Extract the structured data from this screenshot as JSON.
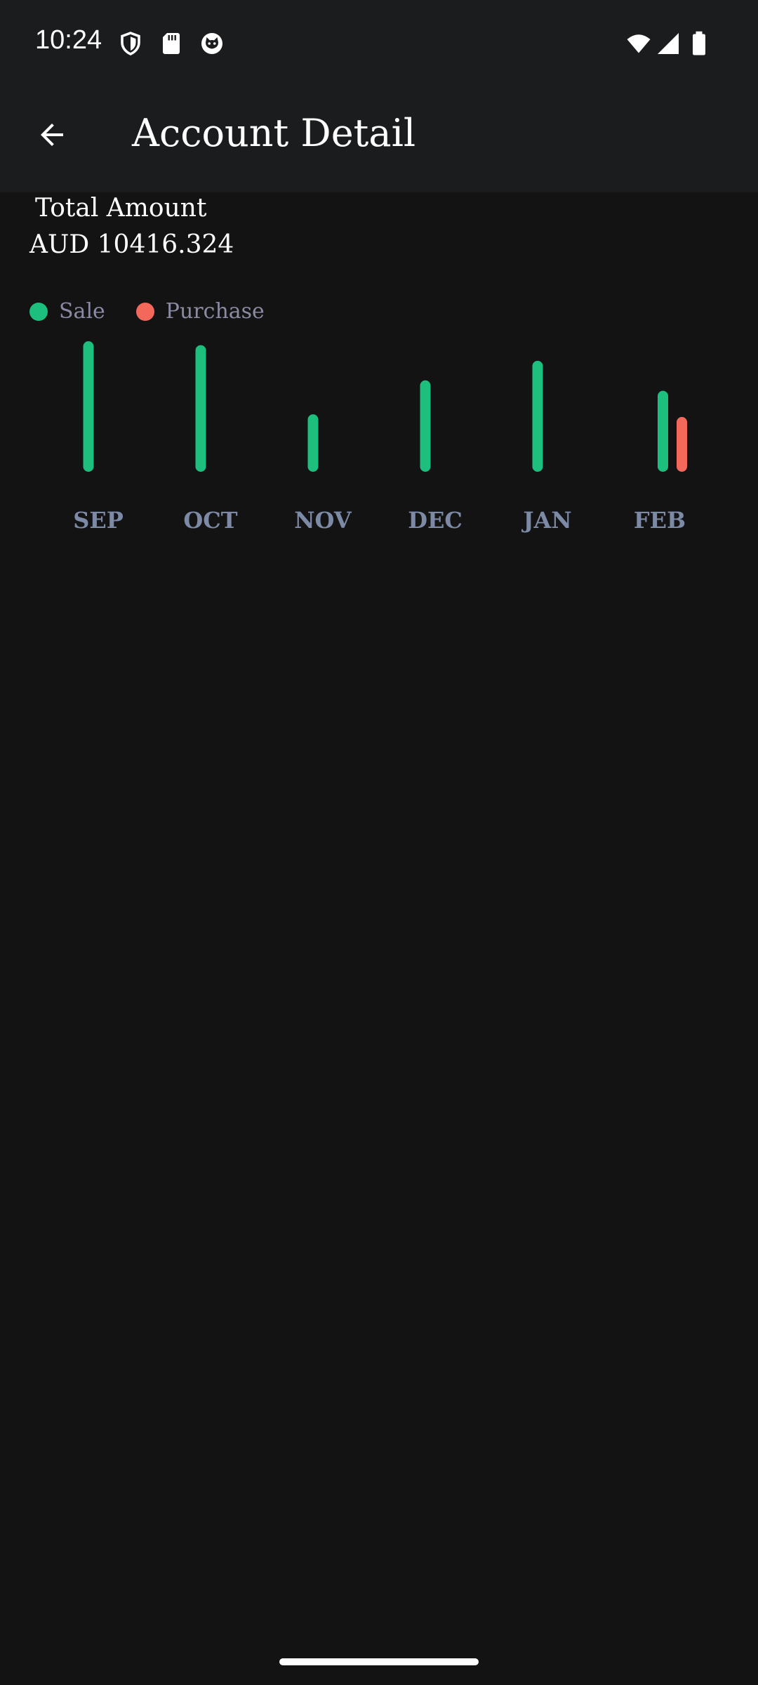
{
  "status_bar": {
    "time": "10:24",
    "left_icons": [
      "shield-icon",
      "sd-card-icon",
      "cat-face-icon"
    ],
    "right_icons": [
      "wifi-icon",
      "signal-icon",
      "battery-icon"
    ]
  },
  "app_bar": {
    "back_icon": "arrow-back-icon",
    "title": "Account Detail"
  },
  "summary": {
    "label": "Total Amount",
    "value": "AUD 10416.324"
  },
  "legend": [
    {
      "label": "Sale",
      "color": "#1cbf7e"
    },
    {
      "label": "Purchase",
      "color": "#f2685a"
    }
  ],
  "chart_data": {
    "type": "bar",
    "categories": [
      "SEP",
      "OCT",
      "NOV",
      "DEC",
      "JAN",
      "FEB"
    ],
    "series": [
      {
        "name": "Sale",
        "color": "#1cbf7e",
        "values": [
          100,
          97,
          44,
          70,
          85,
          62
        ]
      },
      {
        "name": "Purchase",
        "color": "#f2685a",
        "values": [
          0,
          0,
          0,
          0,
          0,
          42
        ]
      }
    ],
    "ylim": [
      0,
      100
    ],
    "grid": false,
    "legend_position": "top-left"
  }
}
